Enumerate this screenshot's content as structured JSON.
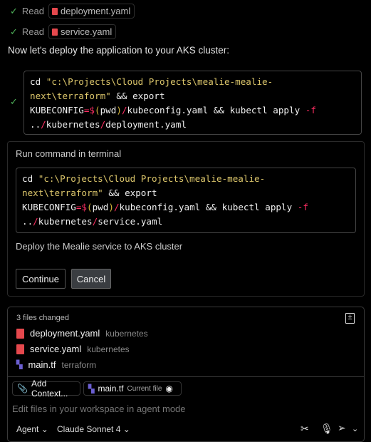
{
  "reads": [
    {
      "label": "Read",
      "file": "deployment.yaml"
    },
    {
      "label": "Read",
      "file": "service.yaml"
    }
  ],
  "intro": "Now let's deploy the application to your AKS cluster:",
  "code1": [
    [
      {
        "t": "cd ",
        "c": ""
      },
      {
        "t": "\"c:\\Projects\\Cloud Projects\\mealie-mealie-",
        "c": "str"
      }
    ],
    [
      {
        "t": "next\\terraform\"",
        "c": "str"
      },
      {
        "t": " && export",
        "c": ""
      }
    ],
    [
      {
        "t": "KUBECONFIG",
        "c": ""
      },
      {
        "t": "=$",
        "c": "op"
      },
      {
        "t": "(",
        "c": "par"
      },
      {
        "t": "pwd",
        "c": ""
      },
      {
        "t": ")",
        "c": "par"
      },
      {
        "t": "/",
        "c": "op"
      },
      {
        "t": "kubeconfig.yaml && kubectl apply ",
        "c": ""
      },
      {
        "t": "-f",
        "c": "op"
      }
    ],
    [
      {
        "t": "..",
        "c": ""
      },
      {
        "t": "/",
        "c": "op"
      },
      {
        "t": "kubernetes",
        "c": ""
      },
      {
        "t": "/",
        "c": "op"
      },
      {
        "t": "deployment.yaml",
        "c": ""
      }
    ]
  ],
  "card": {
    "title": "Run command in terminal",
    "code": [
      [
        {
          "t": "cd ",
          "c": ""
        },
        {
          "t": "\"c:\\Projects\\Cloud Projects\\mealie-mealie-",
          "c": "str"
        }
      ],
      [
        {
          "t": "next\\terraform\"",
          "c": "str"
        },
        {
          "t": " && export",
          "c": ""
        }
      ],
      [
        {
          "t": "KUBECONFIG",
          "c": ""
        },
        {
          "t": "=$",
          "c": "op"
        },
        {
          "t": "(",
          "c": "par"
        },
        {
          "t": "pwd",
          "c": ""
        },
        {
          "t": ")",
          "c": "par"
        },
        {
          "t": "/",
          "c": "op"
        },
        {
          "t": "kubeconfig.yaml && kubectl apply ",
          "c": ""
        },
        {
          "t": "-f",
          "c": "op"
        }
      ],
      [
        {
          "t": "..",
          "c": ""
        },
        {
          "t": "/",
          "c": "op"
        },
        {
          "t": "kubernetes",
          "c": ""
        },
        {
          "t": "/",
          "c": "op"
        },
        {
          "t": "service.yaml",
          "c": ""
        }
      ]
    ],
    "description": "Deploy the Mealie service to AKS cluster",
    "continue": "Continue",
    "cancel": "Cancel"
  },
  "changes": {
    "title": "3 files changed",
    "files": [
      {
        "name": "deployment.yaml",
        "dir": "kubernetes"
      },
      {
        "name": "service.yaml",
        "dir": "kubernetes"
      },
      {
        "name": "main.tf",
        "dir": "terraform"
      }
    ]
  },
  "input": {
    "add_context": "Add Context...",
    "current_file": "main.tf",
    "current_file_label": "Current file",
    "placeholder": "Edit files in your workspace in agent mode",
    "mode": "Agent",
    "model": "Claude Sonnet 4"
  }
}
